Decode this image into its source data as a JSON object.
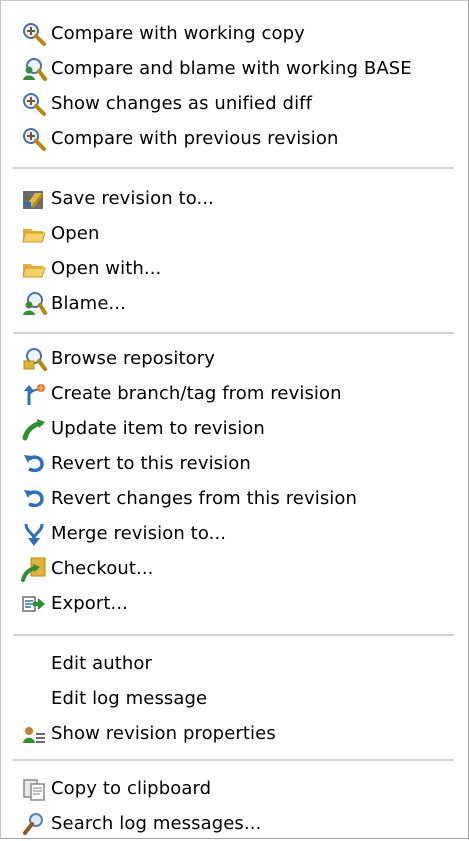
{
  "menu": {
    "items": [
      {
        "label": "Compare with working copy",
        "icon": "magnifier-icon"
      },
      {
        "label": "Compare and blame with working BASE",
        "icon": "blame-magnifier-icon"
      },
      {
        "label": "Show changes as unified diff",
        "icon": "magnifier-icon"
      },
      {
        "label": "Compare with previous revision",
        "icon": "magnifier-icon"
      },
      {
        "label": "Save revision to...",
        "icon": "save-revision-icon"
      },
      {
        "label": "Open",
        "icon": "folder-open-icon"
      },
      {
        "label": "Open with...",
        "icon": "folder-open-icon"
      },
      {
        "label": "Blame...",
        "icon": "blame-icon"
      },
      {
        "label": "Browse repository",
        "icon": "browse-repository-icon"
      },
      {
        "label": "Create branch/tag from revision",
        "icon": "branch-tag-icon"
      },
      {
        "label": "Update item to revision",
        "icon": "update-icon"
      },
      {
        "label": "Revert to this revision",
        "icon": "revert-icon"
      },
      {
        "label": "Revert changes from this revision",
        "icon": "revert-icon"
      },
      {
        "label": "Merge revision to...",
        "icon": "merge-icon"
      },
      {
        "label": "Checkout...",
        "icon": "checkout-icon"
      },
      {
        "label": "Export...",
        "icon": "export-icon"
      },
      {
        "label": "Edit author",
        "icon": ""
      },
      {
        "label": "Edit log message",
        "icon": ""
      },
      {
        "label": "Show revision properties",
        "icon": "properties-icon"
      },
      {
        "label": "Copy to clipboard",
        "icon": "clipboard-icon"
      },
      {
        "label": "Search log messages...",
        "icon": "search-log-icon"
      }
    ]
  },
  "colors": {
    "menu_background": "#ffffff",
    "separator": "#d4d4d4",
    "text": "#000000"
  }
}
